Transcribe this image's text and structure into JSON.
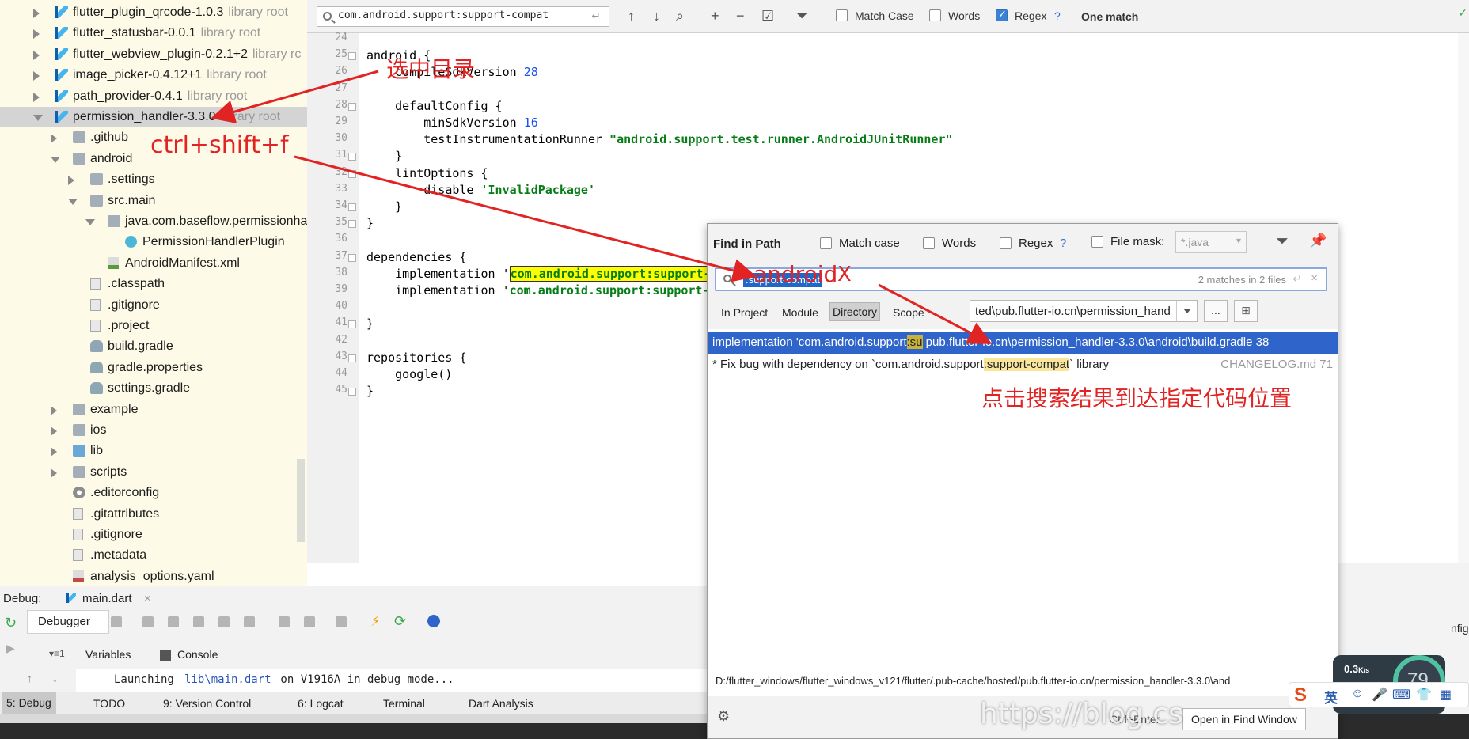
{
  "tree": {
    "items": [
      {
        "name": "flutter_plugin_qrcode-1.0.3",
        "tag": "library root"
      },
      {
        "name": "flutter_statusbar-0.0.1",
        "tag": "library root"
      },
      {
        "name": "flutter_webview_plugin-0.2.1+2",
        "tag": "library rc"
      },
      {
        "name": "image_picker-0.4.12+1",
        "tag": "library root"
      },
      {
        "name": "path_provider-0.4.1",
        "tag": "library root"
      },
      {
        "name": "permission_handler-3.3.0",
        "tag": "library root"
      },
      {
        "name": ".github",
        "tag": ""
      },
      {
        "name": "android",
        "tag": ""
      },
      {
        "name": ".settings",
        "tag": ""
      },
      {
        "name": "src.main",
        "tag": ""
      },
      {
        "name": "java.com.baseflow.permissionha",
        "tag": ""
      },
      {
        "name": "PermissionHandlerPlugin",
        "tag": ""
      },
      {
        "name": "AndroidManifest.xml",
        "tag": ""
      },
      {
        "name": ".classpath",
        "tag": ""
      },
      {
        "name": ".gitignore",
        "tag": ""
      },
      {
        "name": ".project",
        "tag": ""
      },
      {
        "name": "build.gradle",
        "tag": ""
      },
      {
        "name": "gradle.properties",
        "tag": ""
      },
      {
        "name": "settings.gradle",
        "tag": ""
      },
      {
        "name": "example",
        "tag": ""
      },
      {
        "name": "ios",
        "tag": ""
      },
      {
        "name": "lib",
        "tag": ""
      },
      {
        "name": "scripts",
        "tag": ""
      },
      {
        "name": ".editorconfig",
        "tag": ""
      },
      {
        "name": ".gitattributes",
        "tag": ""
      },
      {
        "name": ".gitignore",
        "tag": ""
      },
      {
        "name": ".metadata",
        "tag": ""
      },
      {
        "name": "analysis_options.yaml",
        "tag": ""
      }
    ]
  },
  "searchbar": {
    "query": "com.android.support:support-compat",
    "match_case": "Match Case",
    "words": "Words",
    "regex": "Regex",
    "help": "?",
    "result": "One match"
  },
  "editor": {
    "line_numbers": [
      "24",
      "25",
      "26",
      "27",
      "28",
      "29",
      "30",
      "31",
      "32",
      "33",
      "34",
      "35",
      "36",
      "37",
      "38",
      "39",
      "40",
      "41",
      "42",
      "43",
      "44",
      "45"
    ],
    "lines": [
      {
        "plain": ""
      },
      {
        "plain": "android {"
      },
      {
        "pre": "    compileSdkVersion ",
        "num": "28"
      },
      {
        "plain": ""
      },
      {
        "plain": "    defaultConfig {"
      },
      {
        "pre": "        minSdkVersion ",
        "num": "16"
      },
      {
        "pre": "        testInstrumentationRunner ",
        "str": "\"android.support.test.runner.AndroidJUnitRunner\""
      },
      {
        "plain": "    }"
      },
      {
        "plain": "    lintOptions {"
      },
      {
        "pre": "        disable ",
        "str": "'InvalidPackage'"
      },
      {
        "plain": "    }"
      },
      {
        "plain": "}"
      },
      {
        "plain": ""
      },
      {
        "plain": "dependencies {"
      },
      {
        "pre": "    implementation '",
        "hl": "com.android.support:support-"
      },
      {
        "pre": "    implementation '",
        "str": "com.android.support:support-"
      },
      {
        "plain": ""
      },
      {
        "plain": "}"
      },
      {
        "plain": ""
      },
      {
        "plain": "repositories {"
      },
      {
        "plain": "    google()"
      },
      {
        "plain": "}"
      }
    ]
  },
  "find_dialog": {
    "title": "Find in Path",
    "match_case": "Match case",
    "words": "Words",
    "regex": "Regex",
    "help": "?",
    "file_mask": "File mask:",
    "file_mask_value": "*.java",
    "query_selected": ":support-compat",
    "count": "2 matches in 2 files",
    "scopes": [
      "In Project",
      "Module",
      "Directory",
      "Scope"
    ],
    "directory": "ted\\pub.flutter-io.cn\\permission_handler-3.3.0",
    "browse": "...",
    "results": [
      {
        "pre": "implementation 'com.android.support",
        "mark": ":su",
        "post": " pub.flutter-io.cn\\permission_handler-3.3.0\\android\\build.gradle 38",
        "file": ""
      },
      {
        "pre": "* Fix bug with dependency on `com.android.support",
        "mark": ":support-compat",
        "post": "` library",
        "file": "CHANGELOG.md 71"
      }
    ],
    "path": "D:/flutter_windows/flutter_windows_v121/flutter/.pub-cache/hosted/pub.flutter-io.cn/permission_handler-3.3.0\\and",
    "shortcut": "Ctrl+Enter",
    "open_btn": "Open in Find Window"
  },
  "debug": {
    "label": "Debug:",
    "file_tab": "main.dart",
    "debugger_tab": "Debugger",
    "variables": "Variables",
    "console": "Console",
    "console_pre": "Launching ",
    "console_link": "lib\\main.dart",
    "console_post": " on V1916A in debug mode..."
  },
  "status": {
    "tabs": [
      "5: Debug",
      "TODO",
      "9: Version Control",
      "6: Logcat",
      "Terminal",
      "Dart Analysis"
    ]
  },
  "right": {
    "config": "nfig"
  },
  "annotations": {
    "select_dir": "选中目录",
    "shortcut": "ctrl+shift+f",
    "android": "android",
    "x": "X",
    "click_result": "点击搜索结果到达指定代码位置"
  },
  "widgets": {
    "speed": "0.3",
    "speed_unit": "K/s",
    "percent": "79",
    "ime_logo": "S",
    "ime_lang": "英"
  },
  "watermark": "https://blog.cs",
  "colors": {
    "accent": "#2f65ca",
    "annotation": "#e22323",
    "highlight": "#ffff00"
  }
}
